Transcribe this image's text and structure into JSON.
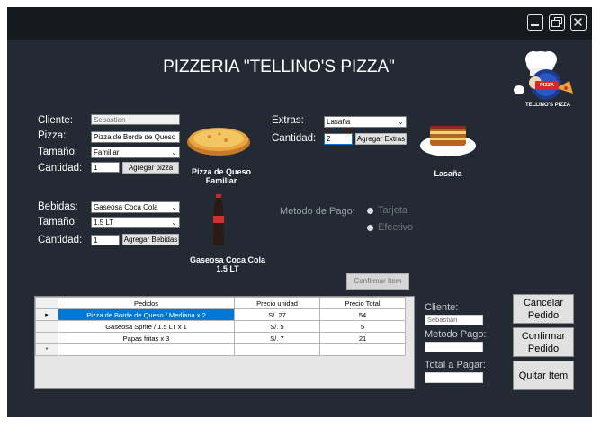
{
  "title": "PIZZERIA \"TELLINO'S PIZZA\"",
  "logo": {
    "text": "TELLINO'S PIZZA",
    "badge": "PIZZA"
  },
  "window_controls": [
    "minimize-icon",
    "maximize-icon",
    "close-icon"
  ],
  "order_form": {
    "cliente_label": "Cliente:",
    "cliente_value": "Sebastian",
    "pizza_label": "Pizza:",
    "pizza_value": "Pizza de Borde de Queso",
    "tamano_label": "Tamaño:",
    "tamano_value": "Familiar",
    "cantidad_label": "Cantidad:",
    "cantidad_value": "1",
    "agregar_pizza": "Agregar pizza",
    "pizza_caption": "Pizza de Queso Familiar"
  },
  "extras_form": {
    "extras_label": "Extras:",
    "extras_value": "Lasaña",
    "cantidad_label": "Cantidad:",
    "cantidad_value": "2",
    "agregar_extras": "Agregar Extras",
    "extras_caption": "Lasaña"
  },
  "drinks_form": {
    "bebidas_label": "Bebidas:",
    "bebidas_value": "Gaseosa Coca Cola",
    "tamano_label": "Tamaño:",
    "tamano_value": "1.5 LT",
    "cantidad_label": "Cantidad:",
    "cantidad_value": "1",
    "agregar_bebidas": "Agregar Bebidas",
    "drink_caption": "Gaseosa Coca Cola 1.5 LT"
  },
  "payment": {
    "label": "Metodo de Pago:",
    "options": [
      "Tarjeta",
      "Efectivo"
    ]
  },
  "confirmar_item": "Confirmar Item",
  "table": {
    "columns": [
      "Pedidos",
      "Precio unidad",
      "Precio Total"
    ],
    "rows": [
      {
        "pedido": "Pizza de Borde de Queso / Mediana x 2",
        "unidad": "S/. 27",
        "total": "54"
      },
      {
        "pedido": "Gaseosa Sprite / 1.5 LT x 1",
        "unidad": "S/. 5",
        "total": "5"
      },
      {
        "pedido": "Papas fritas x 3",
        "unidad": "S/. 7",
        "total": "21"
      }
    ],
    "new_row_marker": "*",
    "current_row_marker": "▸"
  },
  "summary": {
    "cliente_label": "Cliente:",
    "cliente_value": "Sebastian",
    "metodo_label": "Metodo Pago:",
    "metodo_value": "",
    "total_label": "Total a Pagar:",
    "total_value": ""
  },
  "actions": {
    "cancelar": "Cancelar Pedido",
    "confirmar": "Confirmar Pedido",
    "quitar": "Quitar Item"
  },
  "colors": {
    "background": "#232a33",
    "titlebar": "#16191d",
    "selection": "#0078d7"
  }
}
